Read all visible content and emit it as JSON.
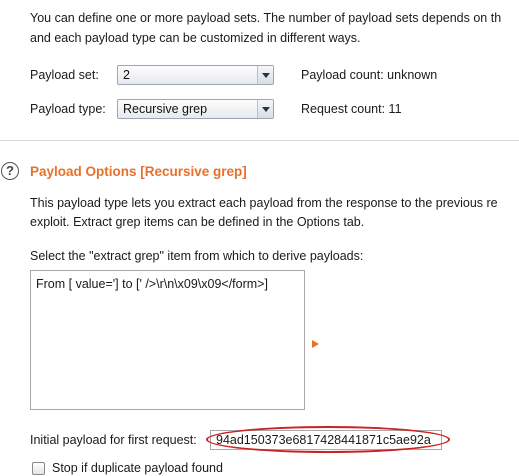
{
  "intro": {
    "line1": "You can define one or more payload sets. The number of payload sets depends on th",
    "line2": "and each payload type can be customized in different ways."
  },
  "payload_set": {
    "label": "Payload set:",
    "value": "2"
  },
  "payload_type": {
    "label": "Payload type:",
    "value": "Recursive grep"
  },
  "payload_count": "Payload count: unknown",
  "request_count": "Request count: 11",
  "options": {
    "help_glyph": "?",
    "title": "Payload Options [Recursive grep]",
    "desc_line1": "This payload type lets you extract each payload from the response to the previous re",
    "desc_line2": "exploit. Extract grep items can be defined in the Options tab.",
    "select_prompt": "Select the \"extract grep\" item from which to derive payloads:",
    "grep_items": [
      "From [ value='] to [' />\\r\\n\\x09\\x09</form>]"
    ],
    "initial_label": "Initial payload for first request:",
    "initial_value": "94ad150373e6817428441871c5ae92a",
    "stop_duplicate_label": "Stop if duplicate payload found"
  },
  "colors": {
    "section_title": "#e8702a",
    "annotation_ellipse": "#cc2222"
  }
}
